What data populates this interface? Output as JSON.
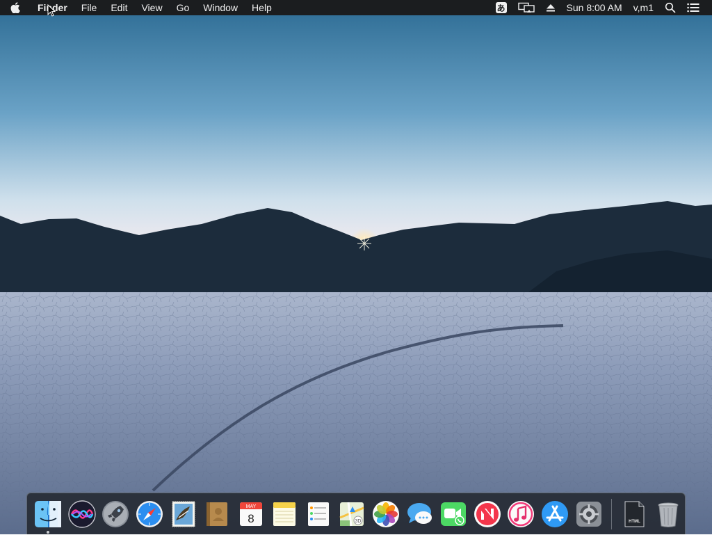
{
  "menubar": {
    "apple_icon": "apple-logo-icon",
    "app_name": "Finder",
    "menus": [
      "File",
      "Edit",
      "View",
      "Go",
      "Window",
      "Help"
    ],
    "status": {
      "input_method_glyph": "あ",
      "display_icon": "airplay-display-icon",
      "eject_icon": "eject-icon",
      "clock": "Sun 8:00 AM",
      "user": "v,m1",
      "spotlight_icon": "search-icon",
      "notification_icon": "list-icon"
    }
  },
  "dock": {
    "apps": [
      {
        "name": "finder",
        "running": true
      },
      {
        "name": "siri"
      },
      {
        "name": "launchpad"
      },
      {
        "name": "safari"
      },
      {
        "name": "mail"
      },
      {
        "name": "contacts"
      },
      {
        "name": "calendar",
        "month": "MAY",
        "day": "8"
      },
      {
        "name": "notes"
      },
      {
        "name": "reminders"
      },
      {
        "name": "maps"
      },
      {
        "name": "photos"
      },
      {
        "name": "messages"
      },
      {
        "name": "facetime"
      },
      {
        "name": "news"
      },
      {
        "name": "itunes"
      },
      {
        "name": "app-store"
      },
      {
        "name": "system-preferences"
      }
    ],
    "others": [
      {
        "name": "html-file",
        "label": "HTML"
      },
      {
        "name": "trash"
      }
    ]
  },
  "colors": {
    "menubar_bg": "#1b1d1f",
    "sky_top": "#2b6a92",
    "sky_horizon": "#f4ecf0",
    "mountains": "#1c2c3c",
    "playa": "#8796b2"
  }
}
